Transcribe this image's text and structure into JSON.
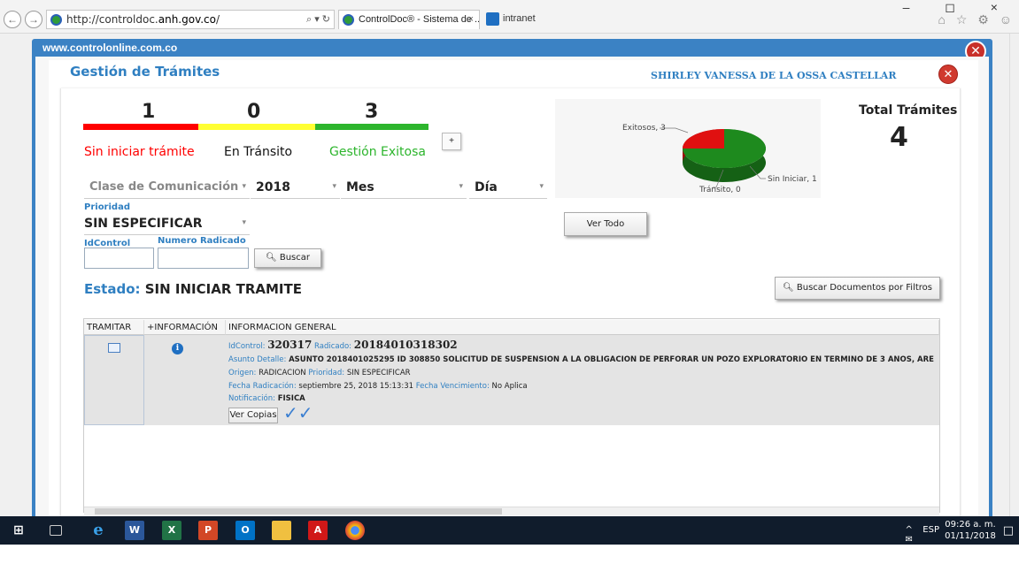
{
  "browser": {
    "url_prefix": "http://controldoc.",
    "url_domain": "anh.gov.co",
    "url_suffix": "/",
    "search_glyph": "⌕ ▾ ↻",
    "tabs": [
      {
        "label": "ControlDoc® - Sistema de ...",
        "close": "×"
      },
      {
        "label": "intranet"
      }
    ],
    "window_controls": "– ◻ ×",
    "toolbar_icons": "⌂ ☆ ⚙ ☺"
  },
  "outer_popup": {
    "title": "www.controlonline.com.co",
    "close": "✕"
  },
  "dialog": {
    "title": "Gestión de Trámites",
    "user": "SHIRLEY VANESSA DE LA OSSA CASTELLAR",
    "close": "✕"
  },
  "stats": [
    {
      "count": "1",
      "label": "Sin iniciar trámite",
      "color": "#ff0000"
    },
    {
      "count": "0",
      "label": "En Tránsito",
      "color": "#ffff33"
    },
    {
      "count": "3",
      "label": "Gestión Exitosa",
      "color": "#2db52d"
    }
  ],
  "plus_button": "+",
  "total": {
    "label": "Total Trámites",
    "value": "4"
  },
  "chart_data": {
    "type": "pie",
    "slices": [
      {
        "label": "Exitosos, 3",
        "value": 3,
        "color": "#1e8a1e"
      },
      {
        "label": "Sin Iniciar, 1",
        "value": 1,
        "color": "#e01010"
      },
      {
        "label": "Tránsito, 0",
        "value": 0,
        "color": "#e8e800"
      }
    ]
  },
  "filters": {
    "clase": "Clase de Comunicación",
    "year": "2018",
    "month": "Mes",
    "day": "Día",
    "prioridad_label": "Prioridad",
    "prioridad_value": "SIN ESPECIFICAR",
    "idcontrol_label": "IdControl",
    "radicado_label": "Numero Radicado",
    "buscar": "Buscar",
    "ver_todo": "Ver Todo",
    "buscar_docs": "Buscar Documentos por Filtros"
  },
  "estado": {
    "key": "Estado:",
    "value": "SIN INICIAR TRAMITE"
  },
  "table": {
    "headers": [
      "TRAMITAR",
      "+INFORMACIÓN",
      "INFORMACION GENERAL"
    ],
    "row": {
      "idcontrol_k": "IdControl:",
      "idcontrol_v": "320317",
      "radicado_k": "Radicado:",
      "radicado_v": "20184010318302",
      "asunto_k": "Asunto Detalle:",
      "asunto_v": "ASUNTO 2018401025295 ID 308850 SOLICITUD DE SUSPENSION A LA OBLIGACION DE PERFORAR UN POZO EXPLORATORIO EN TERMINO DE 3 AÑOS, ARE",
      "origen_k": "Origen:",
      "origen_v": "RADICACION",
      "prioridad_k": "Prioridad:",
      "prioridad_v": "SIN ESPECIFICAR",
      "fecha_k": "Fecha Radicación:",
      "fecha_v": "septiembre 25, 2018 15:13:31",
      "venc_k": "Fecha Vencimiento:",
      "venc_v": "No Aplica",
      "notif_k": "Notificación:",
      "notif_v": "FISICA",
      "ver_copias": "Ver Copias"
    }
  },
  "taskbar": {
    "tray": "ESP",
    "time": "09:26 a. m.",
    "date": "01/11/2018"
  }
}
